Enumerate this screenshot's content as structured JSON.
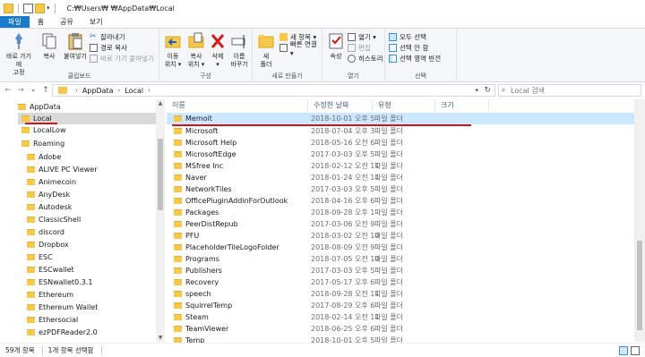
{
  "window": {
    "title_path": "C:₩Users₩          ₩AppData₩Local"
  },
  "ribbon_tabs": [
    "파일",
    "홈",
    "공유",
    "보기"
  ],
  "ribbon": {
    "clipboard": {
      "pin_label": "바로 가기에\n고정",
      "copy_label": "복사",
      "paste_label": "붙여넣기",
      "cut_label": "잘라내기",
      "copy_path_label": "경로 복사",
      "paste_shortcut_label": "바로 가기 붙여넣기",
      "group_label": "클립보드"
    },
    "organize": {
      "move_label": "이동\n위치 ▾",
      "copy_to_label": "복사\n위치 ▾",
      "delete_label": "삭제\n▾",
      "rename_label": "이름\n바꾸기",
      "group_label": "구성"
    },
    "new": {
      "new_folder_label": "새\n폴더",
      "new_item_label": "새 항목 ▾",
      "easy_access_label": "빠른 연결 ▾",
      "group_label": "새로 만들기"
    },
    "open": {
      "properties_label": "속성",
      "open_label": "열기 ▾",
      "edit_label": "편집",
      "history_label": "히스토리",
      "group_label": "열기"
    },
    "select": {
      "select_all_label": "모두 선택",
      "select_none_label": "선택 안 함",
      "invert_label": "선택 영역 반전",
      "group_label": "선택"
    }
  },
  "nav": {
    "breadcrumb": [
      "AppData",
      "Local"
    ],
    "search_placeholder": "Local 검색"
  },
  "tree": [
    "AppData",
    "Local",
    "LocalLow",
    "Roaming",
    "Adobe",
    "ALIVE PC Viewer",
    "Animecoin",
    "AnyDesk",
    "Autodesk",
    "ClassicShell",
    "discord",
    "Dropbox",
    "ESC",
    "ESCwallet",
    "ESNwallet0.3.1",
    "Ethereum",
    "Ethereum Wallet",
    "Ethersocial",
    "ezPDFReader2.0"
  ],
  "columns": {
    "name": "이름",
    "date": "수정한 날짜",
    "type": "유형",
    "size": "크기"
  },
  "files": [
    {
      "name": "Memoit",
      "date": "2018-10-01 오후 5",
      "type": "파일 폴더"
    },
    {
      "name": "Microsoft",
      "date": "2018-07-04 오후 3",
      "type": "파일 폴더"
    },
    {
      "name": "Microsoft Help",
      "date": "2018-05-16 오전 6",
      "type": "파일 폴더"
    },
    {
      "name": "MicrosoftEdge",
      "date": "2017-03-03 오후 5",
      "type": "파일 폴더"
    },
    {
      "name": "MSfree Inc",
      "date": "2018-02-12 오전 11",
      "type": "파일 폴더"
    },
    {
      "name": "Naver",
      "date": "2018-01-24 오전 11",
      "type": "파일 폴더"
    },
    {
      "name": "NetworkTiles",
      "date": "2017-03-03 오후 5",
      "type": "파일 폴더"
    },
    {
      "name": "OfficePluginAddinForOutlook",
      "date": "2018-04-16 오후 6",
      "type": "파일 폴더"
    },
    {
      "name": "Packages",
      "date": "2018-09-28 오후 1",
      "type": "파일 폴더"
    },
    {
      "name": "PeerDistRepub",
      "date": "2017-03-06 오전 9",
      "type": "파일 폴더"
    },
    {
      "name": "PFU",
      "date": "2018-03-02 오전 10",
      "type": "파일 폴더"
    },
    {
      "name": "PlaceholderTileLogoFolder",
      "date": "2018-08-09 오전 9",
      "type": "파일 폴더"
    },
    {
      "name": "Programs",
      "date": "2018-07-05 오전 10",
      "type": "파일 폴더"
    },
    {
      "name": "Publishers",
      "date": "2017-03-03 오후 5",
      "type": "파일 폴더"
    },
    {
      "name": "Recovery",
      "date": "2017-05-17 오후 6",
      "type": "파일 폴더"
    },
    {
      "name": "speech",
      "date": "2018-09-28 오전 11",
      "type": "파일 폴더"
    },
    {
      "name": "SquirrelTemp",
      "date": "2017-08-29 오후 6",
      "type": "파일 폴더"
    },
    {
      "name": "Steam",
      "date": "2018-02-14 오전 11",
      "type": "파일 폴더"
    },
    {
      "name": "TeamViewer",
      "date": "2018-06-25 오후 6",
      "type": "파일 폴더"
    },
    {
      "name": "Temp",
      "date": "2018-10-01 오후 5",
      "type": "파일 폴더"
    }
  ],
  "status": {
    "count": "59개 항목",
    "selected": "1개 항목 선택함"
  },
  "colors": {
    "accent": "#1979ca",
    "selection": "#cce8ff",
    "folder": "#f7c94a",
    "annotation": "#d21414"
  }
}
